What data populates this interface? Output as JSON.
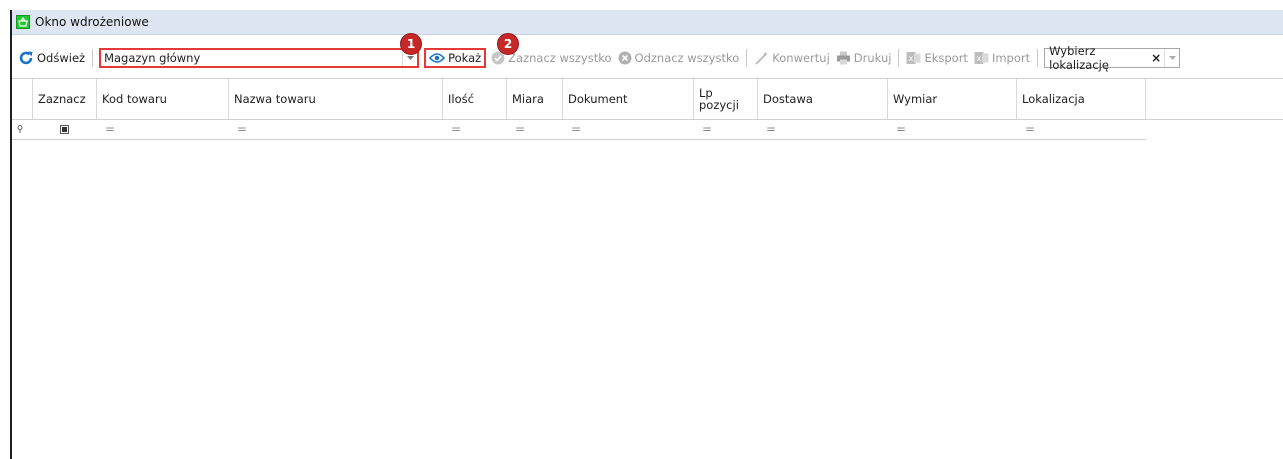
{
  "window": {
    "title": "Okno wdrożeniowe"
  },
  "toolbar": {
    "refresh_label": "Odśwież",
    "warehouse_value": "Magazyn główny",
    "show_label": "Pokaż",
    "select_all_label": "Zaznacz wszystko",
    "deselect_all_label": "Odznacz wszystko",
    "convert_label": "Konwertuj",
    "print_label": "Drukuj",
    "export_label": "Eksport",
    "import_label": "Import",
    "location_value": "Wybierz lokalizację",
    "clear_label": "×"
  },
  "annotations": {
    "badge1": "1",
    "badge2": "2"
  },
  "grid": {
    "columns": [
      "Zaznacz",
      "Kod towaru",
      "Nazwa towaru",
      "Ilość",
      "Miara",
      "Dokument",
      "Lp\npozycji",
      "Dostawa",
      "Wymiar",
      "Lokalizacja"
    ],
    "filter_symbol": "="
  },
  "colors": {
    "accent_red": "#e53935",
    "badge_red": "#c62828",
    "refresh_blue": "#1a73c7"
  }
}
